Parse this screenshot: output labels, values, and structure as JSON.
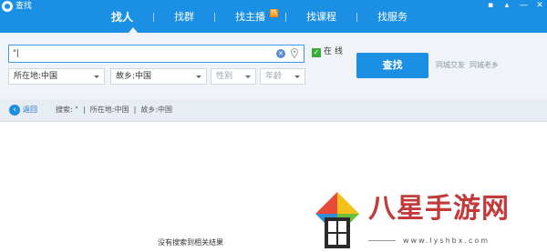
{
  "app": {
    "title": "查找"
  },
  "window_controls": [
    "▪",
    "▴",
    "—",
    "✕"
  ],
  "tabs": [
    {
      "label": "找人",
      "active": true
    },
    {
      "label": "找群",
      "active": false
    },
    {
      "label": "找主播",
      "active": false,
      "badge": "热"
    },
    {
      "label": "找课程",
      "active": false
    },
    {
      "label": "找服务",
      "active": false
    }
  ],
  "search": {
    "value": "\"|",
    "clear_icon": "clear-icon",
    "location_icon": "location-pin-icon",
    "online": {
      "checked": true,
      "label": "在线"
    },
    "filters": {
      "location": "所在地:中国",
      "hometown": "故乡:中国",
      "gender": "性别",
      "age": "年龄"
    },
    "button_label": "查找",
    "links": [
      "同城交友",
      "同城老乡"
    ]
  },
  "breadcrumb": {
    "back_label": "返回",
    "text": "搜索: \"  |  所在地:中国  |  故乡:中国"
  },
  "results": {
    "empty_message": "没有搜索到相关结果"
  },
  "watermark": {
    "title": "八星手游网",
    "url": "www.lyshbx.com"
  },
  "colors": {
    "accent": "#1a8fe3",
    "hot_badge": "#ff8a00",
    "check": "#3caa3c",
    "watermark": "#c23a3a"
  }
}
